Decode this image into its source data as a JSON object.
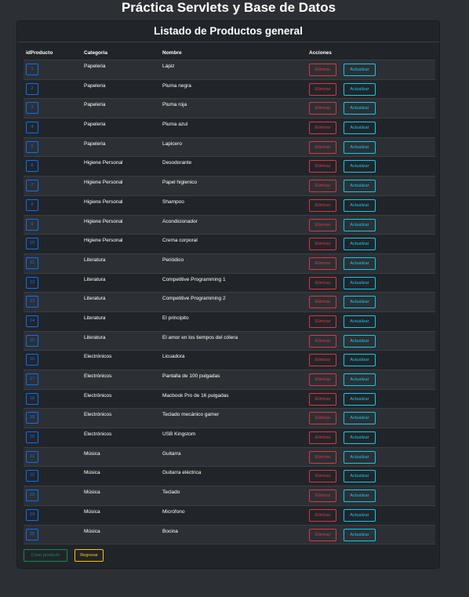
{
  "page": {
    "title": "Práctica Servlets y Base de Datos"
  },
  "card": {
    "title": "Listado de Productos general"
  },
  "table": {
    "headers": {
      "id": "idProducto",
      "category": "Categoria",
      "name": "Nombre",
      "actions": "Acciones"
    },
    "delete_label": "Eliminar",
    "update_label": "Actualizar",
    "rows": [
      {
        "id": "1",
        "category": "Papeleria",
        "name": "Lápiz"
      },
      {
        "id": "2",
        "category": "Papeleria",
        "name": "Pluma negra"
      },
      {
        "id": "3",
        "category": "Papeleria",
        "name": "Pluma roja"
      },
      {
        "id": "4",
        "category": "Papeleria",
        "name": "Pluma azul"
      },
      {
        "id": "5",
        "category": "Papeleria",
        "name": "Lapicero"
      },
      {
        "id": "6",
        "category": "Higiene Personal",
        "name": "Desodorante"
      },
      {
        "id": "7",
        "category": "Higiene Personal",
        "name": "Papel higienico"
      },
      {
        "id": "8",
        "category": "Higiene Personal",
        "name": "Shampoo"
      },
      {
        "id": "9",
        "category": "Higiene Personal",
        "name": "Acondicionador"
      },
      {
        "id": "10",
        "category": "Higiene Personal",
        "name": "Crema corporal"
      },
      {
        "id": "11",
        "category": "Literatura",
        "name": "Periódico"
      },
      {
        "id": "12",
        "category": "Literatura",
        "name": "Competitive Programming 1"
      },
      {
        "id": "13",
        "category": "Literatura",
        "name": "Competitive Programming 2"
      },
      {
        "id": "14",
        "category": "Literatura",
        "name": "El principito"
      },
      {
        "id": "15",
        "category": "Literatura",
        "name": "El amor en los tiempos del cólera"
      },
      {
        "id": "16",
        "category": "Electrónicos",
        "name": "Licuadora"
      },
      {
        "id": "17",
        "category": "Electrónicos",
        "name": "Pantalla de 100 pulgadas"
      },
      {
        "id": "18",
        "category": "Electrónicos",
        "name": "Macbook Pro de 16 pulgadas"
      },
      {
        "id": "19",
        "category": "Electrónicos",
        "name": "Teclado mecánico gamer"
      },
      {
        "id": "20",
        "category": "Electrónicos",
        "name": "USB Kingstom"
      },
      {
        "id": "21",
        "category": "Música",
        "name": "Guitarra"
      },
      {
        "id": "22",
        "category": "Música",
        "name": "Guitarra eléctrica"
      },
      {
        "id": "23",
        "category": "Música",
        "name": "Teclado"
      },
      {
        "id": "24",
        "category": "Música",
        "name": "Micrófono"
      },
      {
        "id": "25",
        "category": "Música",
        "name": "Bocina"
      }
    ]
  },
  "footer": {
    "create_label": "Crear producto",
    "back_label": "Regresar"
  }
}
